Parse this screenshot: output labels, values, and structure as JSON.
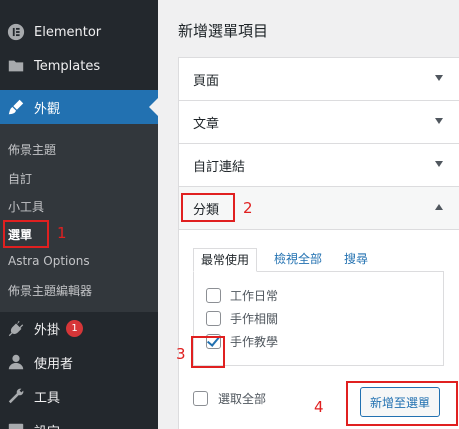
{
  "sidebar": {
    "items": [
      {
        "label": "Elementor",
        "icon": "elementor-icon"
      },
      {
        "label": "Templates",
        "icon": "folder-icon"
      },
      {
        "label": "外觀",
        "icon": "appearance-brush-icon",
        "active": true
      },
      {
        "label": "外掛",
        "icon": "plugins-icon",
        "badge": "1"
      },
      {
        "label": "使用者",
        "icon": "user-icon"
      },
      {
        "label": "工具",
        "icon": "wrench-icon"
      },
      {
        "label": "設定",
        "icon": "settings-icon"
      }
    ],
    "submenu": [
      {
        "label": "佈景主題"
      },
      {
        "label": "自訂"
      },
      {
        "label": "小工具"
      },
      {
        "label": "選單",
        "current": true
      },
      {
        "label": "Astra Options"
      },
      {
        "label": "佈景主題編輯器"
      }
    ]
  },
  "main": {
    "title": "新增選單項目",
    "accordion": [
      {
        "label": "頁面"
      },
      {
        "label": "文章"
      },
      {
        "label": "自訂連結"
      },
      {
        "label": "分類",
        "expanded": true
      }
    ],
    "tabs": [
      "最常使用",
      "檢視全部",
      "搜尋"
    ],
    "categories": [
      {
        "label": "工作日常",
        "checked": false
      },
      {
        "label": "手作相關",
        "checked": false
      },
      {
        "label": "手作教學",
        "checked": true
      }
    ],
    "select_all": "選取全部",
    "add_button": "新增至選單"
  },
  "annotations": {
    "n1": "1",
    "n2": "2",
    "n3": "3",
    "n4": "4",
    "color": "#e02020"
  },
  "colors": {
    "sidebar_bg": "#23282d",
    "submenu_bg": "#32373c",
    "active_blue": "#2271b1",
    "badge_red": "#d63638"
  }
}
